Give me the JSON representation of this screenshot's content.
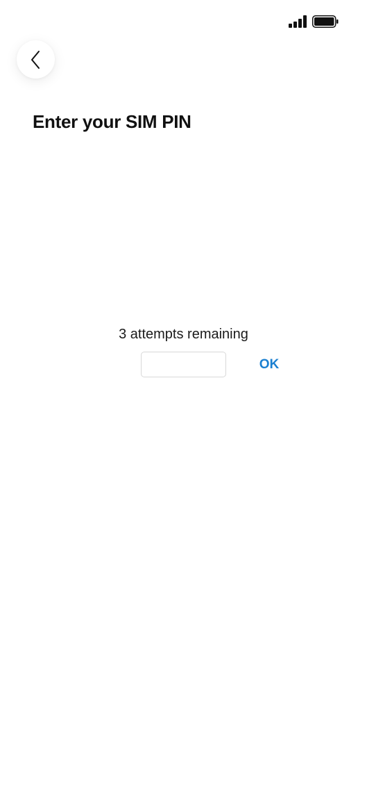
{
  "status_bar": {
    "signal_icon": "cellular-signal-icon",
    "battery_icon": "battery-icon",
    "battery_level": 1.0
  },
  "header": {
    "back_icon": "chevron-left-icon",
    "title": "Enter your SIM PIN"
  },
  "pin_form": {
    "attempts_text": "3 attempts remaining",
    "pin_value": "",
    "pin_placeholder": "",
    "ok_label": "OK"
  },
  "colors": {
    "accent": "#1a7fd0",
    "text": "#111111",
    "background": "#ffffff"
  }
}
